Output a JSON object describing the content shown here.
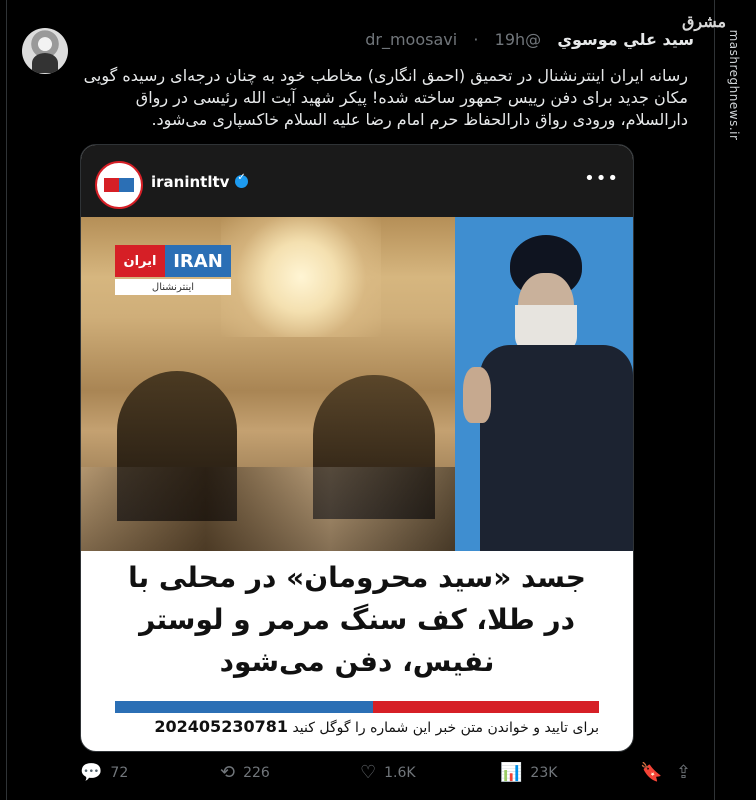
{
  "watermark": {
    "site": "mashreghnews.ir",
    "logo": "مشرق"
  },
  "tweet": {
    "author_name": "سید علي موسوي",
    "handle": "@dr_moosavi",
    "dot": "·",
    "time": "19h",
    "text": "رسانه ایران اینترنشنال در تحمیق (احمق انگاری) مخاطب خود به چنان درجه‌ای رسیده گویی مکان جدید برای دفن رییس جمهور ساخته شده! پیکر شهید آیت الله رئیسی در رواق دارالسلام، ورودی رواق دارالحفاظ حرم امام رضا علیه السلام خاکسپاری می‌شود."
  },
  "card": {
    "account": "iranintltv",
    "overlay_logo_red": "ایران",
    "overlay_logo_blue": "IRAN",
    "overlay_logo_sub": "اینترنشنال",
    "headline_line1": "جسد «سید محرومان» در محلی با",
    "headline_line2": "در طلا، کف سنگ مرمر و لوستر",
    "headline_line3": "نفیس، دفن می‌شود",
    "footer_text": "برای تایید و خواندن متن خبر این شماره را گوگل کنید",
    "footer_number": "202405230781",
    "colors": {
      "red": "#d61f26",
      "blue": "#2b6fb5"
    }
  },
  "actions": {
    "replies": "72",
    "retweets": "226",
    "likes": "1.6K",
    "views": "23K"
  },
  "icons": {
    "reply": "reply-icon",
    "retweet": "retweet-icon",
    "like": "heart-icon",
    "views": "views-icon",
    "bookmark": "bookmark-icon",
    "share": "share-icon"
  }
}
